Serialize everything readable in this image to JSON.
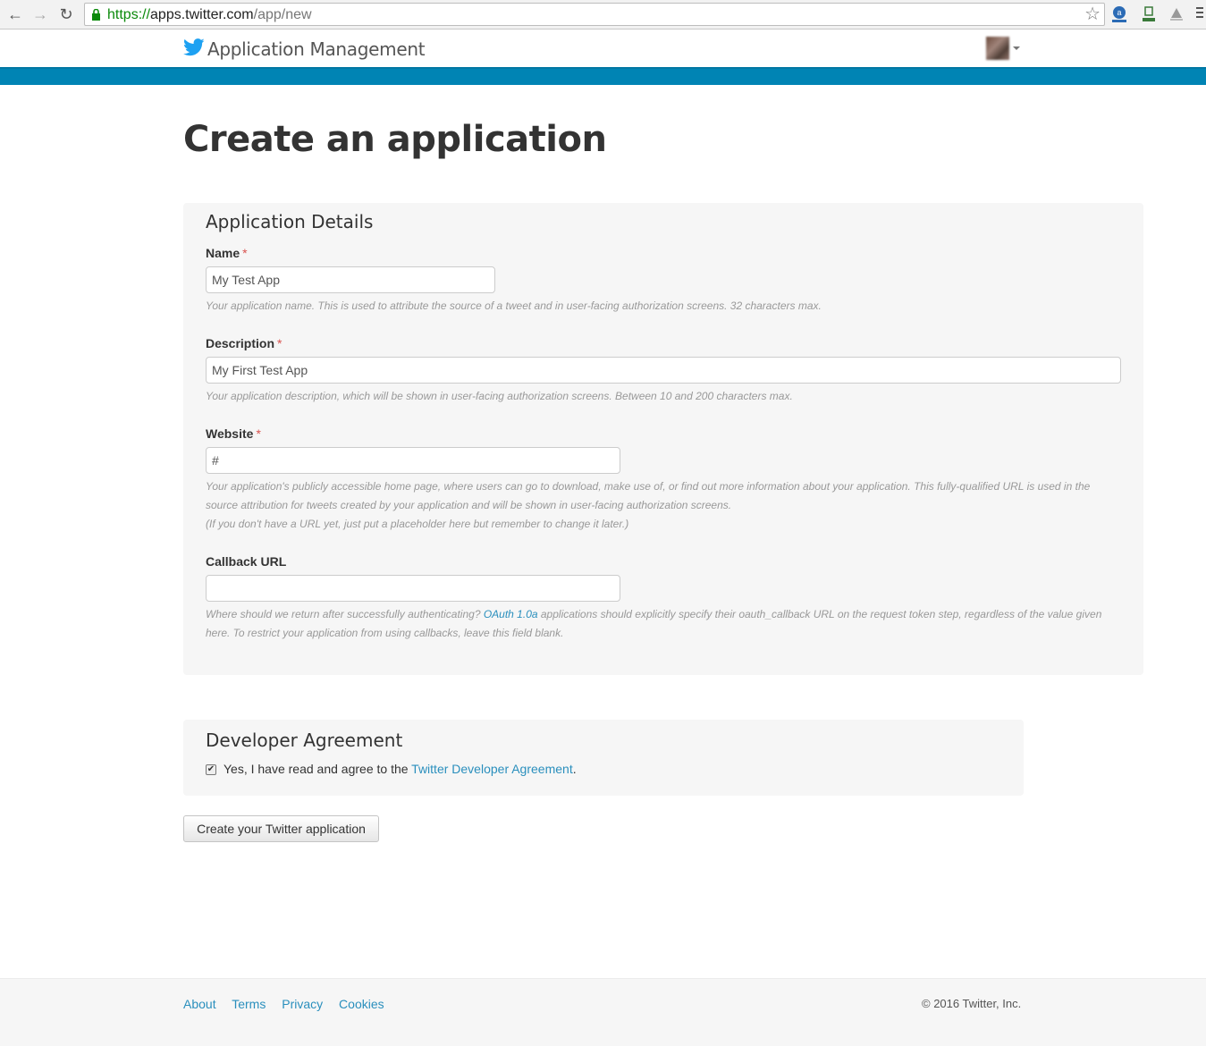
{
  "browser": {
    "url_scheme": "https://",
    "url_host": "apps.twitter.com",
    "url_path": "/app/new"
  },
  "header": {
    "title": "Application Management",
    "brand_color": "#1da1f2",
    "bar_color": "#0084b4"
  },
  "page": {
    "title": "Create an application"
  },
  "details": {
    "title": "Application Details",
    "name_label": "Name",
    "name_value": "My Test App",
    "name_help": "Your application name. This is used to attribute the source of a tweet and in user-facing authorization screens. 32 characters max.",
    "description_label": "Description",
    "description_value": "My First Test App",
    "description_help": "Your application description, which will be shown in user-facing authorization screens. Between 10 and 200 characters max.",
    "website_label": "Website",
    "website_value": "#",
    "website_help_1": "Your application's publicly accessible home page, where users can go to download, make use of, or find out more information about your application. This fully-qualified URL is used in the",
    "website_help_2": "source attribution for tweets created by your application and will be shown in user-facing authorization screens.",
    "website_help_3": "(If you don't have a URL yet, just put a placeholder here but remember to change it later.)",
    "callback_label": "Callback URL",
    "callback_value": "",
    "callback_help_pre": "Where should we return after successfully authenticating? ",
    "callback_help_link": "OAuth 1.0a",
    "callback_help_post": " applications should explicitly specify their oauth_callback URL on the request token step, regardless of the value given",
    "callback_help_2": "here. To restrict your application from using callbacks, leave this field blank.",
    "required_marker": "*"
  },
  "agreement": {
    "title": "Developer Agreement",
    "checked": true,
    "text_pre": "Yes, I have read and agree to the ",
    "link": "Twitter Developer Agreement",
    "text_post": "."
  },
  "submit": {
    "label": "Create your Twitter application"
  },
  "footer": {
    "links": [
      "About",
      "Terms",
      "Privacy",
      "Cookies"
    ],
    "copyright": "© 2016 Twitter, Inc."
  }
}
